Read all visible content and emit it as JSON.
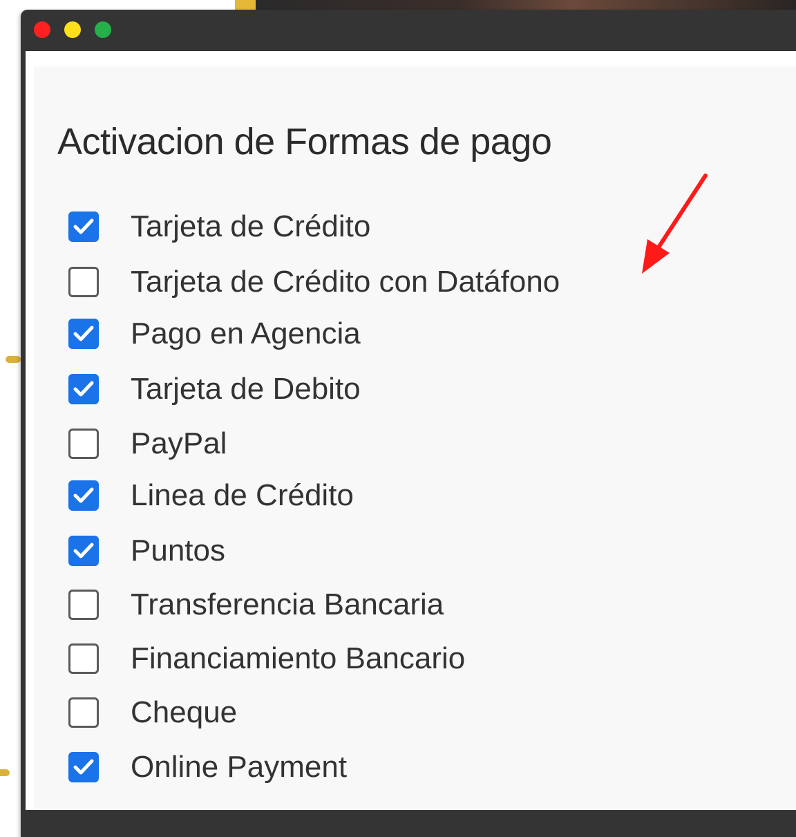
{
  "window": {
    "controls": [
      "close",
      "minimize",
      "maximize"
    ]
  },
  "panel": {
    "title": "Activacion de Formas de pago"
  },
  "payment_methods": [
    {
      "label": "Tarjeta de Crédito",
      "checked": true
    },
    {
      "label": "Tarjeta de Crédito con Datáfono",
      "checked": false
    },
    {
      "label": "Pago en Agencia",
      "checked": true
    },
    {
      "label": "Tarjeta de Debito",
      "checked": true
    },
    {
      "label": "PayPal",
      "checked": false
    },
    {
      "label": "Linea de Crédito",
      "checked": true
    },
    {
      "label": "Puntos",
      "checked": true
    },
    {
      "label": "Transferencia Bancaria",
      "checked": false
    },
    {
      "label": "Financiamiento Bancario",
      "checked": false
    },
    {
      "label": "Cheque",
      "checked": false
    },
    {
      "label": "Online Payment",
      "checked": true
    }
  ],
  "annotation": {
    "icon": "red-arrow-icon",
    "points_to": "Tarjeta de Crédito con Datáfono",
    "color": "#ff1a1a"
  },
  "colors": {
    "checkbox_checked": "#1a73e8",
    "window_frame": "#343434",
    "panel_background": "#f8f8f8"
  }
}
